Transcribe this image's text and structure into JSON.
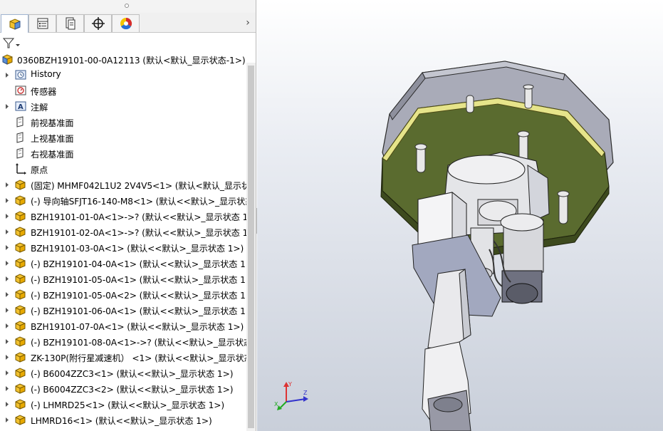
{
  "tabs": [
    {
      "name": "feature-manager-tab",
      "icon": "feature-tree-icon",
      "active": true
    },
    {
      "name": "property-manager-tab",
      "icon": "property-list-icon",
      "active": false
    },
    {
      "name": "configuration-manager-tab",
      "icon": "configuration-icon",
      "active": false
    },
    {
      "name": "dimxpert-tab",
      "icon": "crosshair-icon",
      "active": false
    },
    {
      "name": "display-manager-tab",
      "icon": "color-wheel-icon",
      "active": false
    }
  ],
  "tree": {
    "root": "0360BZH19101-00-0A12113  (默认<默认_显示状态-1>)",
    "items": [
      {
        "label": "History",
        "icon": "history-icon",
        "expander": true
      },
      {
        "label": "传感器",
        "icon": "sensor-icon",
        "expander": false
      },
      {
        "label": "注解",
        "icon": "annotation-icon",
        "expander": true
      },
      {
        "label": "前视基准面",
        "icon": "plane-icon",
        "expander": false
      },
      {
        "label": "上视基准面",
        "icon": "plane-icon",
        "expander": false
      },
      {
        "label": "右视基准面",
        "icon": "plane-icon",
        "expander": false
      },
      {
        "label": "原点",
        "icon": "origin-icon",
        "expander": false
      },
      {
        "label": "(固定) MHMF042L1U2 2V4V5<1> (默认<默认_显示状",
        "icon": "part-icon",
        "expander": true
      },
      {
        "label": "(-) 导向轴SFJT16-140-M8<1> (默认<<默认>_显示状态",
        "icon": "part-icon",
        "expander": true
      },
      {
        "label": "BZH19101-01-0A<1>->? (默认<<默认>_显示状态 1>",
        "icon": "part-icon",
        "expander": true
      },
      {
        "label": "BZH19101-02-0A<1>->? (默认<<默认>_显示状态 1>",
        "icon": "part-icon",
        "expander": true
      },
      {
        "label": "BZH19101-03-0A<1> (默认<<默认>_显示状态 1>)",
        "icon": "part-icon",
        "expander": true
      },
      {
        "label": "(-) BZH19101-04-0A<1> (默认<<默认>_显示状态 1>",
        "icon": "part-icon",
        "expander": true
      },
      {
        "label": "(-) BZH19101-05-0A<1> (默认<<默认>_显示状态 1>",
        "icon": "part-icon",
        "expander": true
      },
      {
        "label": "(-) BZH19101-05-0A<2> (默认<<默认>_显示状态 1>",
        "icon": "part-icon",
        "expander": true
      },
      {
        "label": "(-) BZH19101-06-0A<1> (默认<<默认>_显示状态 1>",
        "icon": "part-icon",
        "expander": true
      },
      {
        "label": "BZH19101-07-0A<1> (默认<<默认>_显示状态 1>)",
        "icon": "part-icon",
        "expander": true
      },
      {
        "label": "(-) BZH19101-08-0A<1>->? (默认<<默认>_显示状态",
        "icon": "part-icon",
        "expander": true
      },
      {
        "label": "ZK-130P(附行星减速机） <1> (默认<<默认>_显示状态",
        "icon": "part-icon",
        "expander": true
      },
      {
        "label": "(-) B6004ZZC3<1> (默认<<默认>_显示状态 1>)",
        "icon": "part-icon",
        "expander": true
      },
      {
        "label": "(-) B6004ZZC3<2> (默认<<默认>_显示状态 1>)",
        "icon": "part-icon",
        "expander": true
      },
      {
        "label": "(-) LHMRD25<1> (默认<<默认>_显示状态 1>)",
        "icon": "part-icon",
        "expander": true
      },
      {
        "label": "LHMRD16<1> (默认<<默认>_显示状态 1>)",
        "icon": "part-icon",
        "expander": true
      }
    ]
  },
  "triad": {
    "x_label": "X",
    "y_label": "Y",
    "z_label": "Z"
  },
  "colors": {
    "accent": "#4a78c2",
    "part_yellow": "#f2c12e",
    "plate_green": "#5a6b2f",
    "plate_trim": "#e6e48a",
    "axis_x": "#d33",
    "axis_y": "#2a2",
    "axis_z": "#33c"
  }
}
